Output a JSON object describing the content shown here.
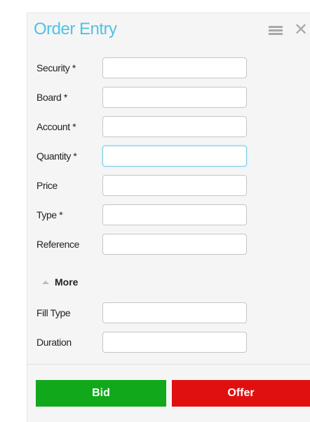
{
  "panel": {
    "title": "Order Entry",
    "menu_icon": "hamburger-menu-icon",
    "close_icon": "close-icon"
  },
  "fields": [
    {
      "label": "Security *",
      "value": ""
    },
    {
      "label": "Board *",
      "value": ""
    },
    {
      "label": "Account *",
      "value": ""
    },
    {
      "label": "Quantity *",
      "value": "",
      "focused": true
    },
    {
      "label": "Price",
      "value": ""
    },
    {
      "label": "Type *",
      "value": ""
    },
    {
      "label": "Reference",
      "value": ""
    }
  ],
  "more": {
    "label": "More",
    "icon": "chevron-up-icon"
  },
  "more_fields": [
    {
      "label": "Fill Type",
      "value": ""
    },
    {
      "label": "Duration",
      "value": ""
    }
  ],
  "actions": {
    "bid_label": "Bid",
    "offer_label": "Offer",
    "bid_color": "#11a81c",
    "offer_color": "#e01010"
  },
  "colors": {
    "title": "#4fc3e6",
    "focus_border": "#7fcce6"
  }
}
